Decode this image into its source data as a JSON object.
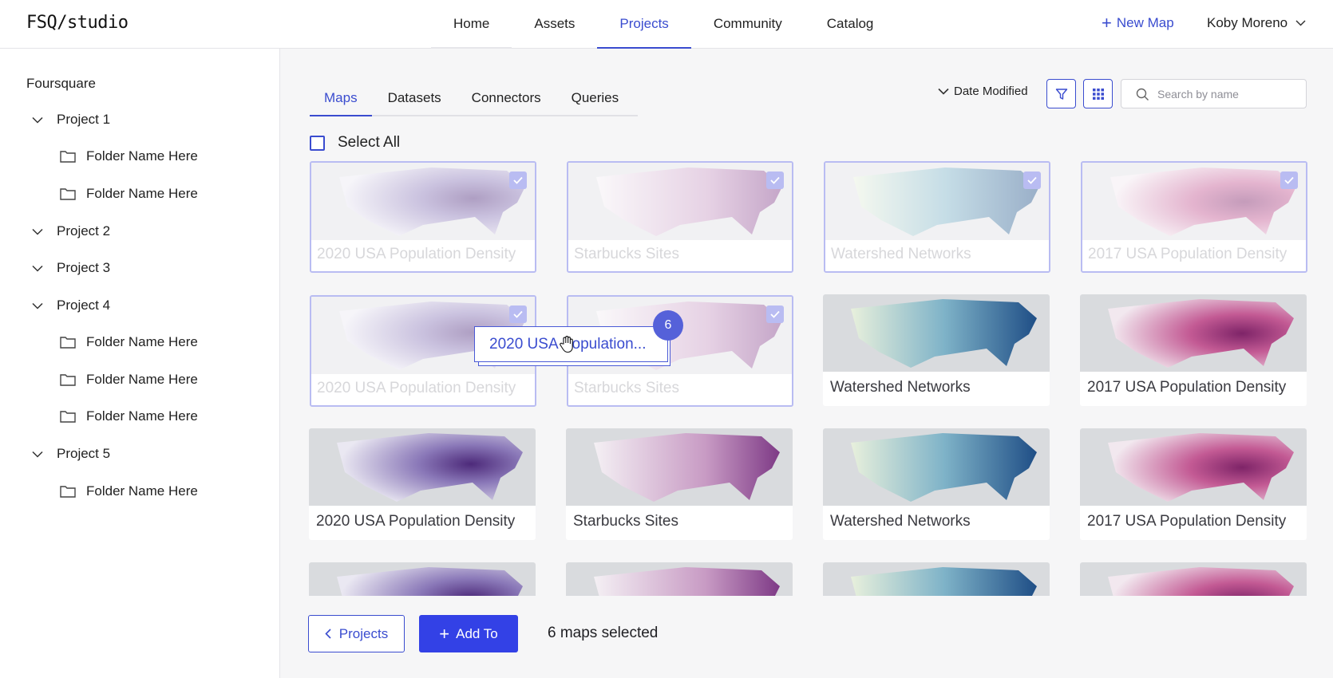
{
  "app": {
    "logo": "FSQ/studio"
  },
  "nav": {
    "items": [
      {
        "label": "Home"
      },
      {
        "label": "Assets"
      },
      {
        "label": "Projects"
      },
      {
        "label": "Community"
      },
      {
        "label": "Catalog"
      }
    ],
    "active": "Projects",
    "new_map_label": "New Map",
    "user_name": "Koby Moreno"
  },
  "sidebar": {
    "org": "Foursquare",
    "project1": "Project 1",
    "project2": "Project 2",
    "project3": "Project 3",
    "project4": "Project 4",
    "project5": "Project 5",
    "folder": "Folder Name Here"
  },
  "tabs": {
    "maps": "Maps",
    "datasets": "Datasets",
    "connectors": "Connectors",
    "queries": "Queries"
  },
  "toolbar": {
    "sort_label": "Date Modified",
    "search_placeholder": "Search by name"
  },
  "select_all_label": "Select All",
  "maps": {
    "pop2020": "2020 USA Population Density",
    "starbucks": "Starbucks Sites",
    "watershed": "Watershed Networks",
    "pop2017": "2017 USA Population Density"
  },
  "drag": {
    "label": "2020 USA Population...",
    "count": "6"
  },
  "footer": {
    "back_label": "Projects",
    "add_label": "Add To",
    "selected_text": "6 maps selected"
  },
  "colors": {
    "accent": "#3a4ccf",
    "primary_button": "#3341e6",
    "selected_border": "#b9bcf2"
  }
}
